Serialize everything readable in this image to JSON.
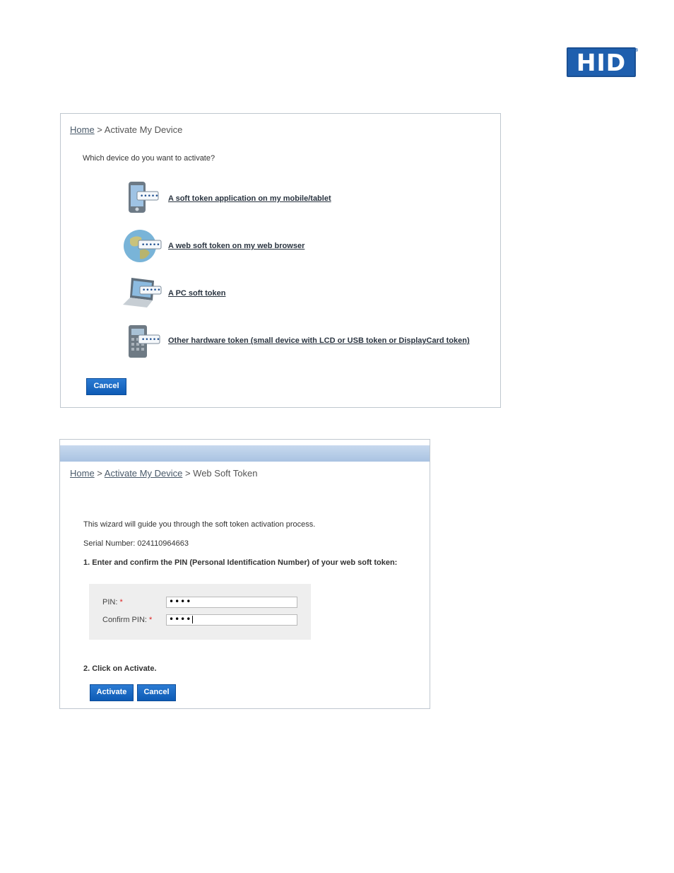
{
  "logo": {
    "text": "HID",
    "registered": "®"
  },
  "panel1": {
    "breadcrumb": {
      "home": "Home",
      "sep": " > ",
      "current": "Activate My Device"
    },
    "question": "Which device do you want to activate?",
    "options": [
      {
        "icon": "mobile-phone-icon",
        "label": "A soft token application on my mobile/tablet"
      },
      {
        "icon": "globe-icon",
        "label": "A web soft token on my web browser"
      },
      {
        "icon": "laptop-icon",
        "label": "A PC soft token"
      },
      {
        "icon": "hardware-token-icon",
        "label": "Other hardware token (small device with LCD or USB token or DisplayCard token)"
      }
    ],
    "cancel_label": "Cancel"
  },
  "panel2": {
    "breadcrumb": {
      "home": "Home",
      "sep1": " > ",
      "activate": "Activate My Device",
      "sep2": " > ",
      "current": "Web Soft Token"
    },
    "intro": "This wizard will guide you through the soft token activation process.",
    "serial": "Serial Number: 024110964663",
    "step1": "1. Enter and confirm the PIN (Personal Identification Number) of your web soft token:",
    "pin_label": "PIN:",
    "pin_value": "••••",
    "confirm_label": "Confirm PIN:",
    "confirm_value": "••••",
    "required_mark": "*",
    "step2": "2. Click on Activate.",
    "activate_label": "Activate",
    "cancel_label": "Cancel"
  },
  "colors": {
    "brand": "#1f5fae",
    "button": "#1366c2",
    "header_bar": "#b7cde8",
    "required": "#dd2222"
  }
}
